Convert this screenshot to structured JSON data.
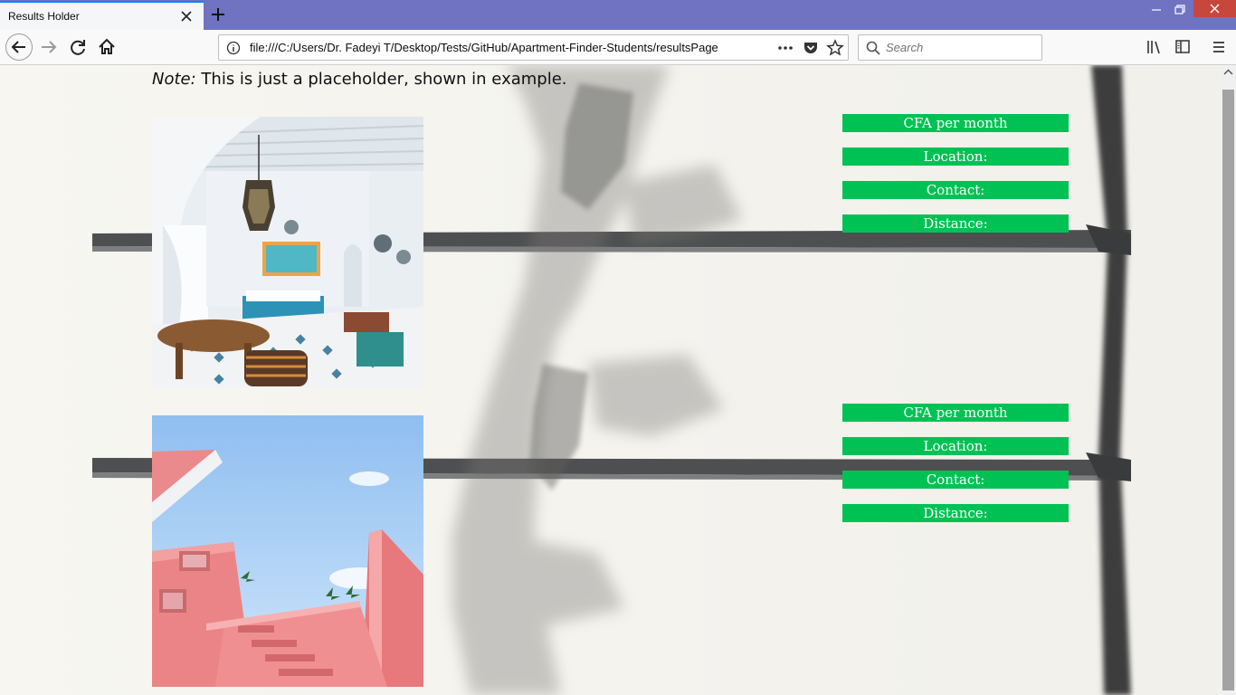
{
  "browser": {
    "tab_title": "Results Holder",
    "url": "file:///C:/Users/Dr. Fadeyi T/Desktop/Tests/GitHub/Apartment-Finder-Students/resultsPage",
    "search_placeholder": "Search"
  },
  "page": {
    "note_label": "Note:",
    "note_text": " This is just a placeholder, shown in example."
  },
  "listings": [
    {
      "photo": "moroccan-living-room-photo",
      "price_label": "CFA per month",
      "location_label": "Location:",
      "contact_label": "Contact:",
      "distance_label": "Distance:"
    },
    {
      "photo": "pink-building-photo",
      "price_label": "CFA per month",
      "location_label": "Location:",
      "contact_label": "Contact:",
      "distance_label": "Distance:"
    }
  ],
  "colors": {
    "accent_bar": "#00c254",
    "tab_strip": "#6f73c2",
    "window_close": "#c7473c"
  }
}
